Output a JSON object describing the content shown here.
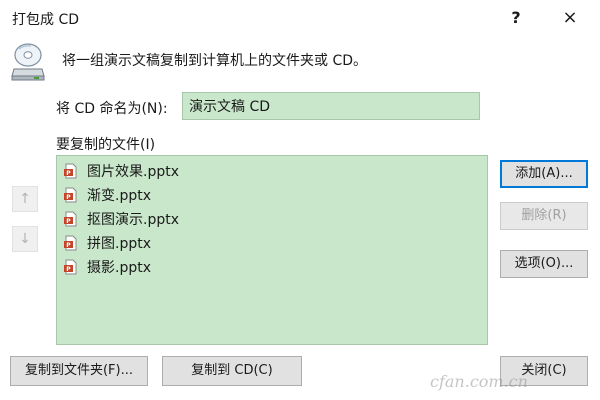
{
  "window": {
    "title": "打包成 CD",
    "help": "?",
    "close": "×"
  },
  "description": "将一组演示文稿复制到计算机上的文件夹或 CD。",
  "name_field": {
    "label": "将 CD 命名为(N):",
    "value": "演示文稿 CD"
  },
  "files": {
    "label": "要复制的文件(I)",
    "items": [
      "图片效果.pptx",
      "渐变.pptx",
      "抠图演示.pptx",
      "拼图.pptx",
      "摄影.pptx"
    ]
  },
  "arrows": {
    "up": "↑",
    "down": "↓"
  },
  "buttons": {
    "add": "添加(A)...",
    "delete": "删除(R)",
    "options": "选项(O)...",
    "copy_folder": "复制到文件夹(F)...",
    "copy_cd": "复制到 CD(C)",
    "close": "关闭(C)"
  },
  "watermark": "cfan.com.cn",
  "colors": {
    "list_bg": "#c9e7cb",
    "accent": "#0078d7",
    "file_icon": "#c5452b"
  }
}
